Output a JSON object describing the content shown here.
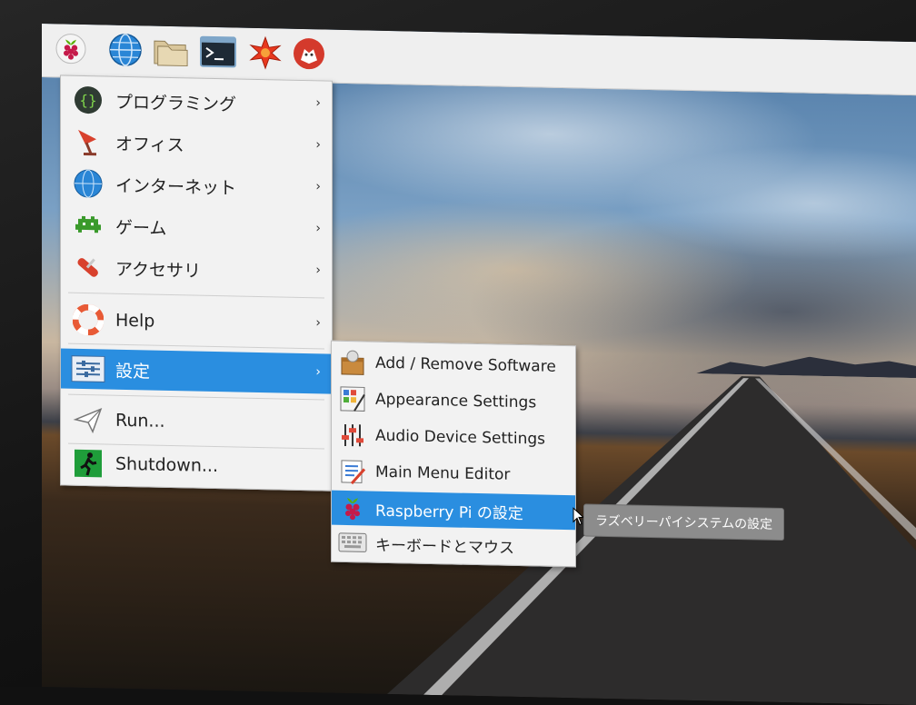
{
  "colors": {
    "menu_bg": "#f2f2f2",
    "highlight": "#2a8ee0",
    "taskbar_bg": "#efefef",
    "tooltip_bg": "#8c8c8c"
  },
  "taskbar": {
    "items": [
      {
        "icon": "raspberry-icon"
      },
      {
        "icon": "web-browser-icon"
      },
      {
        "icon": "file-manager-icon"
      },
      {
        "icon": "terminal-icon"
      },
      {
        "icon": "mathematica-icon"
      },
      {
        "icon": "wolfram-icon"
      }
    ]
  },
  "main_menu": {
    "items": [
      {
        "label": "プログラミング",
        "icon": "programming-icon",
        "submenu": true
      },
      {
        "label": "オフィス",
        "icon": "office-icon",
        "submenu": true
      },
      {
        "label": "インターネット",
        "icon": "internet-icon",
        "submenu": true
      },
      {
        "label": "ゲーム",
        "icon": "games-icon",
        "submenu": true
      },
      {
        "label": "アクセサリ",
        "icon": "accessories-icon",
        "submenu": true
      },
      {
        "label": "Help",
        "icon": "help-icon",
        "submenu": true
      },
      {
        "label": "設定",
        "icon": "preferences-icon",
        "submenu": true,
        "active": true
      },
      {
        "label": "Run...",
        "icon": "run-icon",
        "submenu": false
      },
      {
        "label": "Shutdown...",
        "icon": "shutdown-icon",
        "submenu": false
      }
    ]
  },
  "sub_menu": {
    "items": [
      {
        "label": "Add / Remove Software",
        "icon": "package-icon"
      },
      {
        "label": "Appearance Settings",
        "icon": "appearance-icon"
      },
      {
        "label": "Audio Device Settings",
        "icon": "audio-icon"
      },
      {
        "label": "Main Menu Editor",
        "icon": "menu-editor-icon"
      },
      {
        "label": "Raspberry Pi の設定",
        "icon": "raspberry-icon",
        "active": true
      },
      {
        "label": "キーボードとマウス",
        "icon": "keyboard-icon"
      }
    ]
  },
  "tooltip": {
    "text": "ラズベリーパイシステムの設定"
  },
  "arrow_glyph": "›"
}
